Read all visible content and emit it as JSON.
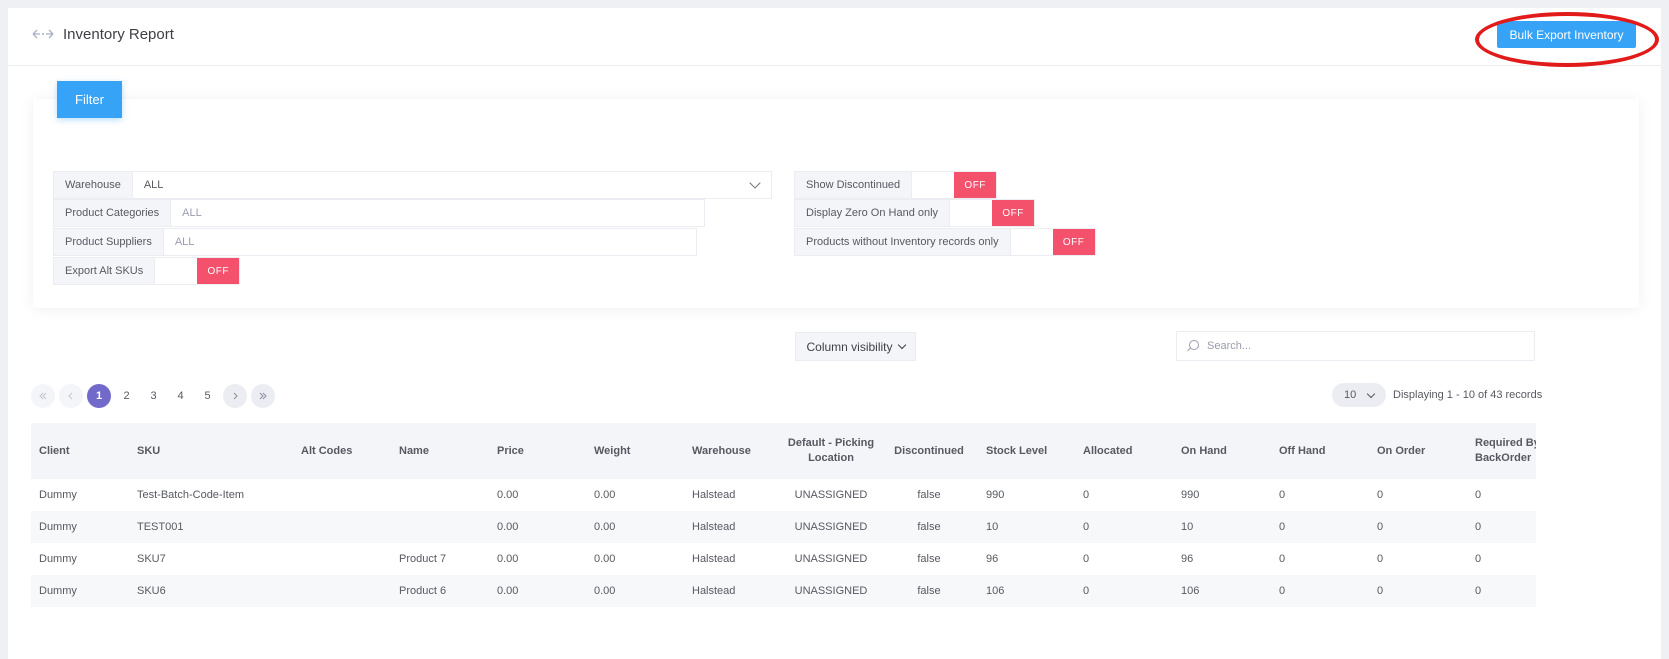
{
  "header": {
    "title": "Inventory Report",
    "bulk_export_label": "Bulk Export Inventory"
  },
  "filter": {
    "tab_label": "Filter",
    "warehouse": {
      "label": "Warehouse",
      "value": "ALL"
    },
    "product_categories": {
      "label": "Product Categories",
      "placeholder": "ALL"
    },
    "product_suppliers": {
      "label": "Product Suppliers",
      "placeholder": "ALL"
    },
    "export_alt_skus": {
      "label": "Export Alt SKUs",
      "state": "OFF"
    },
    "show_discontinued": {
      "label": "Show Discontinued",
      "state": "OFF"
    },
    "display_zero_on_hand": {
      "label": "Display Zero On Hand only",
      "state": "OFF"
    },
    "products_without_inventory": {
      "label": "Products without Inventory records only",
      "state": "OFF"
    }
  },
  "toolbar": {
    "column_visibility_label": "Column visibility",
    "search_placeholder": "Search..."
  },
  "pagination": {
    "pages": [
      "1",
      "2",
      "3",
      "4",
      "5"
    ],
    "active_page": "1",
    "page_size": "10",
    "records_info": "Displaying 1 - 10 of 43 records"
  },
  "table": {
    "columns": [
      "Client",
      "SKU",
      "Alt Codes",
      "Name",
      "Price",
      "Weight",
      "Warehouse",
      "Default - Picking Location",
      "Discontinued",
      "Stock Level",
      "Allocated",
      "On Hand",
      "Off Hand",
      "On Order",
      "Required By BackOrder"
    ],
    "rows": [
      [
        "Dummy",
        "Test-Batch-Code-Item",
        "",
        "",
        "0.00",
        "0.00",
        "Halstead",
        "UNASSIGNED",
        "false",
        "990",
        "0",
        "990",
        "0",
        "0",
        "0"
      ],
      [
        "Dummy",
        "TEST001",
        "",
        "",
        "0.00",
        "0.00",
        "Halstead",
        "UNASSIGNED",
        "false",
        "10",
        "0",
        "10",
        "0",
        "0",
        "0"
      ],
      [
        "Dummy",
        "SKU7",
        "",
        "Product 7",
        "0.00",
        "0.00",
        "Halstead",
        "UNASSIGNED",
        "false",
        "96",
        "0",
        "96",
        "0",
        "0",
        "0"
      ],
      [
        "Dummy",
        "SKU6",
        "",
        "Product 6",
        "0.00",
        "0.00",
        "Halstead",
        "UNASSIGNED",
        "false",
        "106",
        "0",
        "106",
        "0",
        "0",
        "0"
      ]
    ]
  },
  "colors": {
    "primary": "#36a3f7",
    "toggle_off": "#f4516c",
    "active_page": "#716aca",
    "highlight_circle": "#e11a1a"
  }
}
